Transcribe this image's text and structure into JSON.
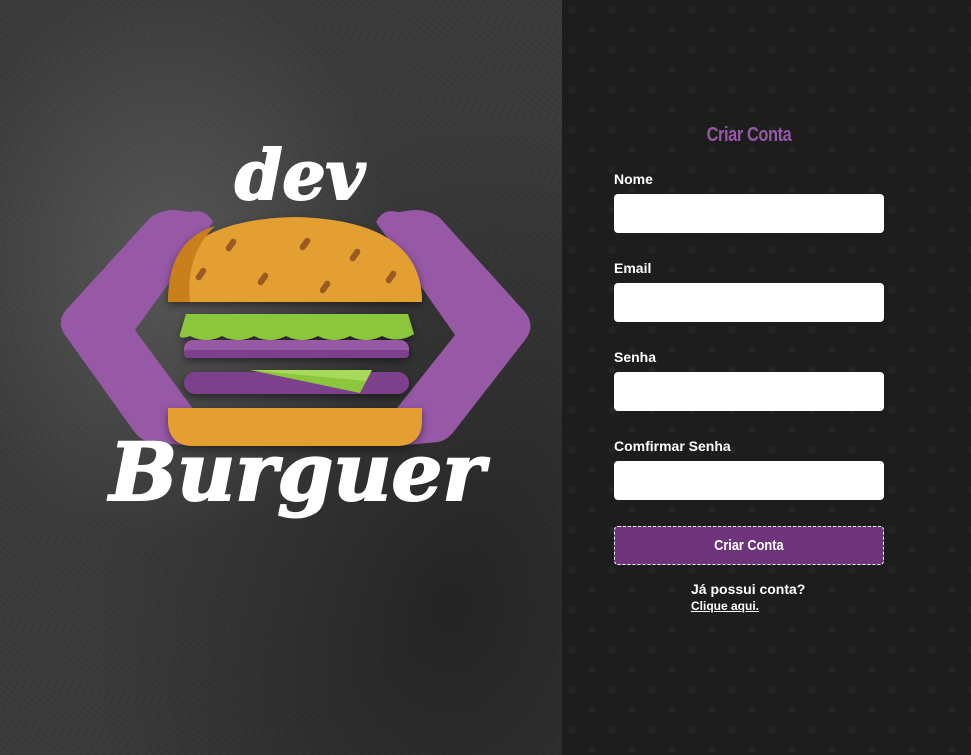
{
  "logo": {
    "top_text": "dev",
    "bottom_text": "Burguer"
  },
  "form": {
    "title": "Criar Conta",
    "fields": [
      {
        "label": "Nome",
        "value": ""
      },
      {
        "label": "Email",
        "value": ""
      },
      {
        "label": "Senha",
        "value": ""
      },
      {
        "label": "Comfirmar Senha",
        "value": ""
      }
    ],
    "submit_label": "Criar Conta",
    "login_prompt": "Já possui conta?",
    "login_link": "Clique aqui."
  },
  "colors": {
    "accent": "#9758a6",
    "button": "#6f357c",
    "panel_bg": "#1d1d1e",
    "bun": "#e39f30",
    "lettuce": "#8cc63e"
  },
  "icons": [
    "brand-logo-icon",
    "code-bracket-left-icon",
    "code-bracket-right-icon",
    "burger-icon"
  ]
}
